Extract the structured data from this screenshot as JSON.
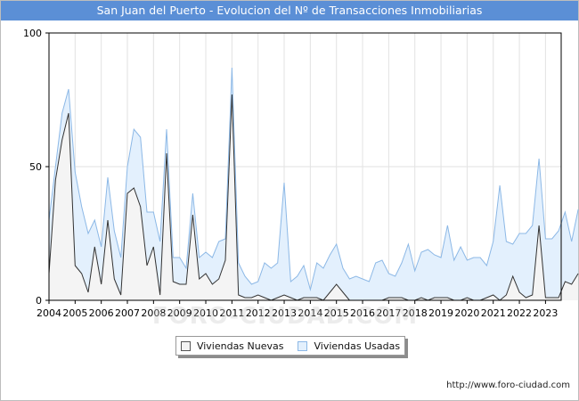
{
  "title": "San Juan del Puerto - Evolucion del Nº de Transacciones Inmobiliarias",
  "watermark": "FORO-CIUDAD.COM",
  "source_url": "http://www.foro-ciudad.com",
  "colors": {
    "title_bar": "#5b8fd6",
    "nuevas_fill": "#f4f4f4",
    "nuevas_line": "#333333",
    "usadas_fill": "#e3f0fd",
    "usadas_line": "#8cb8e6"
  },
  "chart_data": {
    "type": "area",
    "stacked": true,
    "title": "San Juan del Puerto - Evolucion del Nº de Transacciones Inmobiliarias",
    "xlabel": "",
    "ylabel": "",
    "xlim": [
      2004,
      2023.6
    ],
    "ylim": [
      0,
      100
    ],
    "y_ticks": [
      "0",
      "50",
      "100"
    ],
    "x_ticks": [
      "2004",
      "2005",
      "2006",
      "2007",
      "2008",
      "2009",
      "2010",
      "2011",
      "2012",
      "2013",
      "2014",
      "2015",
      "2016",
      "2017",
      "2018",
      "2019",
      "2020",
      "2021",
      "2022",
      "2023"
    ],
    "grid": true,
    "legend_position": "bottom-center",
    "x_start": 2004,
    "x_step": 0.25,
    "series": [
      {
        "name": "Viviendas Nuevas",
        "values": [
          10,
          45,
          60,
          70,
          13,
          10,
          3,
          20,
          6,
          30,
          8,
          2,
          40,
          42,
          35,
          13,
          20,
          2,
          55,
          7,
          6,
          6,
          32,
          8,
          10,
          6,
          8,
          15,
          77,
          2,
          1,
          1,
          2,
          1,
          0,
          1,
          2,
          1,
          0,
          1,
          1,
          1,
          0,
          3,
          6,
          3,
          0,
          0,
          0,
          0,
          0,
          0,
          1,
          1,
          1,
          0,
          0,
          1,
          0,
          1,
          1,
          1,
          0,
          0,
          1,
          0,
          0,
          1,
          2,
          0,
          2,
          9,
          3,
          1,
          2,
          28,
          1,
          1,
          1,
          7,
          6,
          10
        ]
      },
      {
        "name": "Viviendas Usadas",
        "values": [
          20,
          5,
          10,
          9,
          35,
          25,
          22,
          10,
          14,
          16,
          18,
          14,
          10,
          22,
          26,
          20,
          13,
          20,
          9,
          9,
          10,
          6,
          8,
          8,
          8,
          10,
          14,
          8,
          10,
          12,
          8,
          5,
          5,
          13,
          12,
          13,
          42,
          6,
          9,
          12,
          3,
          13,
          12,
          14,
          15,
          9,
          8,
          9,
          8,
          7,
          14,
          15,
          9,
          8,
          13,
          21,
          11,
          17,
          19,
          16,
          15,
          27,
          15,
          20,
          14,
          16,
          16,
          12,
          20,
          43,
          20,
          12,
          22,
          24,
          26,
          25,
          22,
          22,
          25,
          26,
          16,
          24
        ]
      }
    ]
  },
  "legend": {
    "nuevas": "Viviendas Nuevas",
    "usadas": "Viviendas Usadas"
  }
}
